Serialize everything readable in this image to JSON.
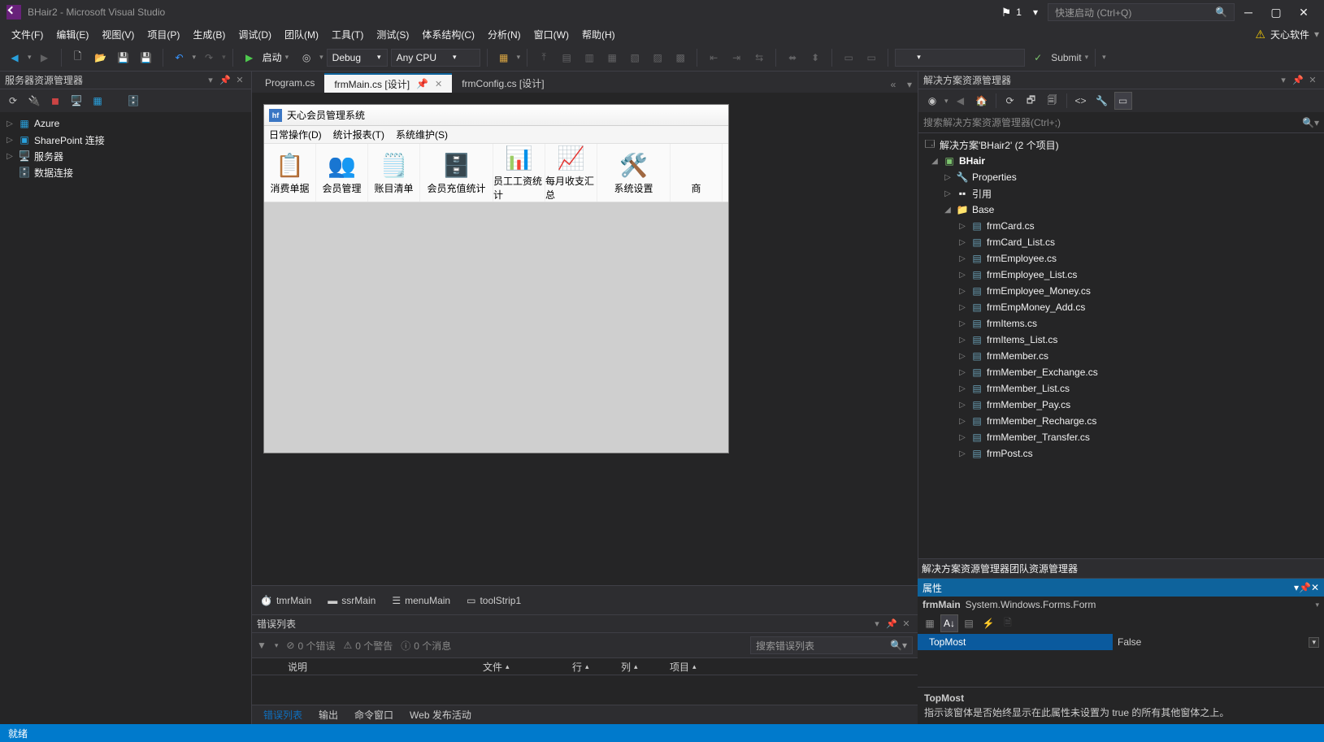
{
  "title": "BHair2 - Microsoft Visual Studio",
  "notif_count": "1",
  "quick_launch_placeholder": "快速启动 (Ctrl+Q)",
  "brand_text": "天心软件",
  "menubar": [
    "文件(F)",
    "编辑(E)",
    "视图(V)",
    "项目(P)",
    "生成(B)",
    "调试(D)",
    "团队(M)",
    "工具(T)",
    "测试(S)",
    "体系结构(C)",
    "分析(N)",
    "窗口(W)",
    "帮助(H)"
  ],
  "toolbar": {
    "start": "启动",
    "config": "Debug",
    "platform": "Any CPU",
    "submit": "Submit"
  },
  "server_explorer": {
    "title": "服务器资源管理器",
    "items": [
      {
        "icon": "azure-icon",
        "label": "Azure",
        "color": "#29a0dc"
      },
      {
        "icon": "sharepoint-icon",
        "label": "SharePoint 连接",
        "color": "#29a0dc"
      },
      {
        "icon": "server-icon",
        "label": "服务器",
        "color": "#c5a24a"
      },
      {
        "icon": "db-icon",
        "label": "数据连接",
        "color": "#c5a24a"
      }
    ]
  },
  "doc_tabs": [
    {
      "label": "Program.cs",
      "active": false
    },
    {
      "label": "frmMain.cs [设计]",
      "active": true
    },
    {
      "label": "frmConfig.cs [设计]",
      "active": false
    }
  ],
  "form_designer": {
    "title": "天心会员管理系统",
    "menus": [
      "日常操作(D)",
      "统计报表(T)",
      "系统维护(S)"
    ],
    "tools": [
      {
        "label": "消费单据",
        "emoji": "📋"
      },
      {
        "label": "会员管理",
        "emoji": "👥"
      },
      {
        "label": "账目清单",
        "emoji": "🗒️"
      },
      {
        "label": "会员充值统计",
        "emoji": "🗄️"
      },
      {
        "label": "员工工资统计",
        "emoji": "📊"
      },
      {
        "label": "每月收支汇总",
        "emoji": "📈"
      },
      {
        "label": "系统设置",
        "emoji": "🛠️"
      },
      {
        "label": "商",
        "emoji": ""
      }
    ]
  },
  "components": [
    "tmrMain",
    "ssrMain",
    "menuMain",
    "toolStrip1"
  ],
  "error_list": {
    "title": "错误列表",
    "errors": "0 个错误",
    "warnings": "0 个警告",
    "messages": "0 个消息",
    "search_ph": "搜索错误列表",
    "cols": [
      "说明",
      "文件",
      "行",
      "列",
      "项目"
    ]
  },
  "bottom_tabs": [
    "错误列表",
    "输出",
    "命令窗口",
    "Web 发布活动"
  ],
  "solution": {
    "title": "解决方案资源管理器",
    "search_ph": "搜索解决方案资源管理器(Ctrl+;)",
    "root": "解决方案'BHair2' (2 个项目)",
    "project": "BHair",
    "props": "Properties",
    "refs": "引用",
    "folder": "Base",
    "files": [
      "frmCard.cs",
      "frmCard_List.cs",
      "frmEmployee.cs",
      "frmEmployee_List.cs",
      "frmEmployee_Money.cs",
      "frmEmpMoney_Add.cs",
      "frmItems.cs",
      "frmItems_List.cs",
      "frmMember.cs",
      "frmMember_Exchange.cs",
      "frmMember_List.cs",
      "frmMember_Pay.cs",
      "frmMember_Recharge.cs",
      "frmMember_Transfer.cs",
      "frmPost.cs"
    ]
  },
  "right_tabs": [
    "解决方案资源管理器",
    "团队资源管理器"
  ],
  "properties": {
    "title": "属性",
    "obj_name": "frmMain",
    "obj_type": "System.Windows.Forms.Form",
    "prop_name": "TopMost",
    "prop_value": "False",
    "desc_title": "TopMost",
    "desc_text": "指示该窗体是否始终显示在此属性未设置为 true 的所有其他窗体之上。"
  },
  "status": "就绪"
}
